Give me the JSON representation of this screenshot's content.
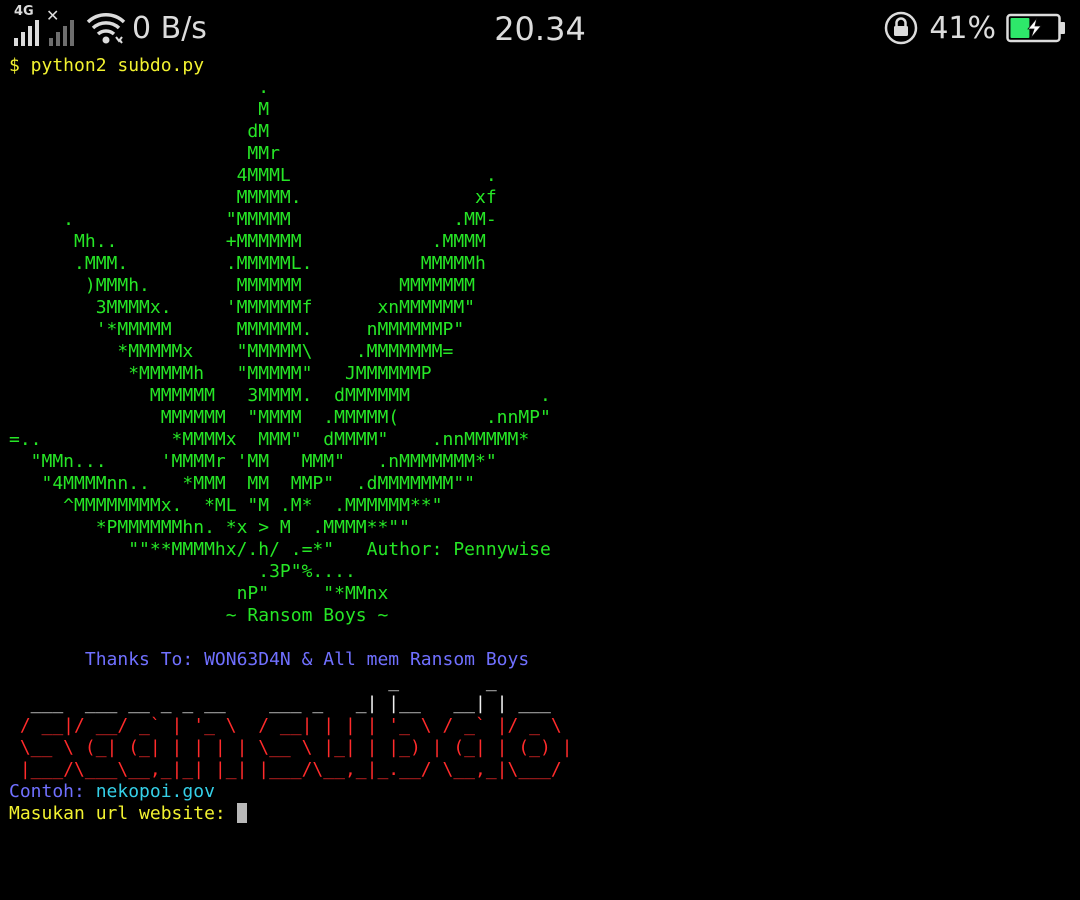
{
  "status_bar": {
    "network_label": "4G",
    "speed": "0 B/s",
    "time": "20.34",
    "battery_percent": "41%",
    "battery_level": 0.41,
    "battery_color": "#2ee86a",
    "icons": [
      "signal-icon",
      "signal-no-sim-icon",
      "wifi-icon",
      "rotation-lock-icon",
      "battery-charging-icon"
    ]
  },
  "terminal": {
    "command": "$ python2 subdo.py",
    "ascii_art": "                       .\n                       M\n                      dM\n                      MMr\n                     4MMML                  .\n                     MMMMM.                xf\n     .              \"MMMMM               .MM-\n      Mh..          +MMMMMM            .MMMM\n      .MMM.         .MMMMML.          MMMMMh\n       )MMMh.        MMMMMM         MMMMMMM\n        3MMMMx.     'MMMMMMf      xnMMMMMM\"\n        '*MMMMM      MMMMMM.     nMMMMMMP\"\n          *MMMMMx    \"MMMMM\\    .MMMMMMM=\n           *MMMMMh   \"MMMMM\"   JMMMMMMP\n             MMMMMM   3MMMM.  dMMMMMM            .\n              MMMMMM  \"MMMM  .MMMMM(        .nnMP\"\n=..            *MMMMx  MMM\"  dMMMM\"    .nnMMMMM*\n  \"MMn...     'MMMMr 'MM   MMM\"   .nMMMMMMM*\"\n   \"4MMMMnn..   *MMM  MM  MMP\"  .dMMMMMMM\"\"\n     ^MMMMMMMMx.  *ML \"M .M*  .MMMMMM**\"\n        *PMMMMMMhn. *x > M  .MMMM**\"\"\n           \"\"**MMMMhx/.h/ .=*\"   Author: Pennywise\n                       .3P\"%....\n                     nP\"     \"*MMnx\n                    ~ Ransom Boys ~",
    "thanks": "       Thanks To: WON63D4N & All mem Ransom Boys",
    "banner_top": "                                   _        _\n  ___  ___ __ _ _ __    ___ _   _| |__   __| | ___",
    "banner_mid": " / __|/ __/ _` | '_ \\  / __| | | | '_ \\ / _` |/ _ \\\n \\__ \\ (_| (_| | | | | \\__ \\ |_| | |_) | (_| | (_) |",
    "banner_bottom": " |___/\\___\\__,_|_| |_| |___/\\__,_|_.__/ \\__,_|\\___/",
    "example_label": "Contoh: ",
    "example_value": "nekopoi.gov",
    "prompt": "Masukan url website: "
  }
}
